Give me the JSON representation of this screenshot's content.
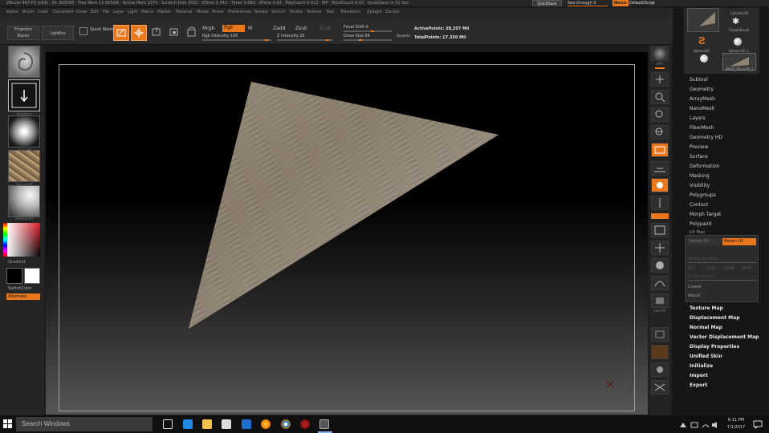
{
  "titlebar": {
    "title": "ZBrush 4R7 P3 (x64) · ID: 003000 · Free Mem 15.655GB · Active Mem 2373 · Scratch Disk 2532 · ZTime 0.342 · Timer 0.083 · ATime 0.63 · PolyCount 0.012 · MP · PointCount 0.02 · QuickSave In 51 Sec",
    "quicksave_label": "QuickSave",
    "seethrough_label": "See-through 0",
    "menus_label": "Menus",
    "default_script_label": "DefaultZScript"
  },
  "menubar": {
    "items": [
      "Alpha",
      "Brush",
      "Color",
      "Document",
      "Draw",
      "Edit",
      "File",
      "Layer",
      "Light",
      "Macro",
      "Marker",
      "Material",
      "Movie",
      "Picker",
      "Preferences",
      "Render",
      "Stencil",
      "Stroke",
      "Texture",
      "Tool",
      "Transform",
      "Zplugin",
      "Zscript"
    ]
  },
  "toolbar": {
    "projection_master": "Projection Master",
    "lightbox": "LightBox",
    "quick_sketch": "Quick Sketch",
    "edit": "Edit",
    "draw": "Draw",
    "move": "Move",
    "scale": "Scale",
    "rotate": "Rotate",
    "mrgb": "Mrgb",
    "rgb": "Rgb",
    "m": "M",
    "rgb_intensity": "Rgb Intensity 100",
    "zadd": "Zadd",
    "zsub": "Zsub",
    "zcut": "Zcut",
    "z_intensity": "Z Intensity 25",
    "focal_shift": "Focal Shift 0",
    "draw_size": "Draw Size 64",
    "dynamic": "Dynamic",
    "active_points": "ActivePoints: 28,207 Mil",
    "total_points": "TotalPoints: 27.350 Mil"
  },
  "leftshelf": {
    "thumbs": [
      "Standard",
      "DragRect",
      "AlphaOff",
      "TextureOff",
      "SkinShade4"
    ],
    "gradient_label": "Gradient",
    "switch_color_label": "SwitchColor",
    "alternate_label": "Alternate"
  },
  "rightshelf": {
    "buttons": [
      "BPR",
      "SPix 3",
      "Scroll",
      "Zoom",
      "Actual",
      "AAHalf",
      "Persp",
      "Floor",
      "Local",
      "L.Sym",
      "XYZ",
      "Frame",
      "Move",
      "Scale",
      "Rotate",
      "Line Fill",
      "PolyF",
      "Transp",
      "Dynamic",
      "Solo",
      "Xpose"
    ]
  },
  "subtools": {
    "items": [
      "PM3D_Plane3D",
      "Cylinder3D",
      "SimpleBrush",
      "Sphere3D",
      "Sphere3D_1",
      "PM3D_Plane3D_1"
    ]
  },
  "tool_menu": {
    "entries": [
      "Subtool",
      "Geometry",
      "ArrayMesh",
      "NanoMesh",
      "Layers",
      "FiberMesh",
      "Geometry HD",
      "Preview",
      "Surface",
      "Deformation",
      "Masking",
      "Visibility",
      "Polygroups",
      "Contact",
      "Morph Target",
      "Polypaint",
      "UV Map"
    ],
    "uv_panel": {
      "delete_uv": "Delete UV",
      "morph_uv": "Morph UV",
      "uv_map_size": "UV Map Size 2048",
      "sizes": [
        "512",
        "1024",
        "2048",
        "4096"
      ],
      "uv_map_border": "UV Map Border 4",
      "create": "Create",
      "adjust": "Adjust"
    },
    "lower_entries": [
      "Texture Map",
      "Displacement Map",
      "Normal Map",
      "Vector Displacement Map",
      "Display Properties",
      "Unified Skin",
      "Initialize",
      "Import",
      "Export"
    ]
  },
  "taskbar": {
    "search_placeholder": "Search Windows",
    "time": "6:11 PM",
    "date": "7/1/2017"
  },
  "colors": {
    "accent": "#e8781b",
    "panel": "#2a2a2a",
    "mesh": "#8e8273"
  }
}
